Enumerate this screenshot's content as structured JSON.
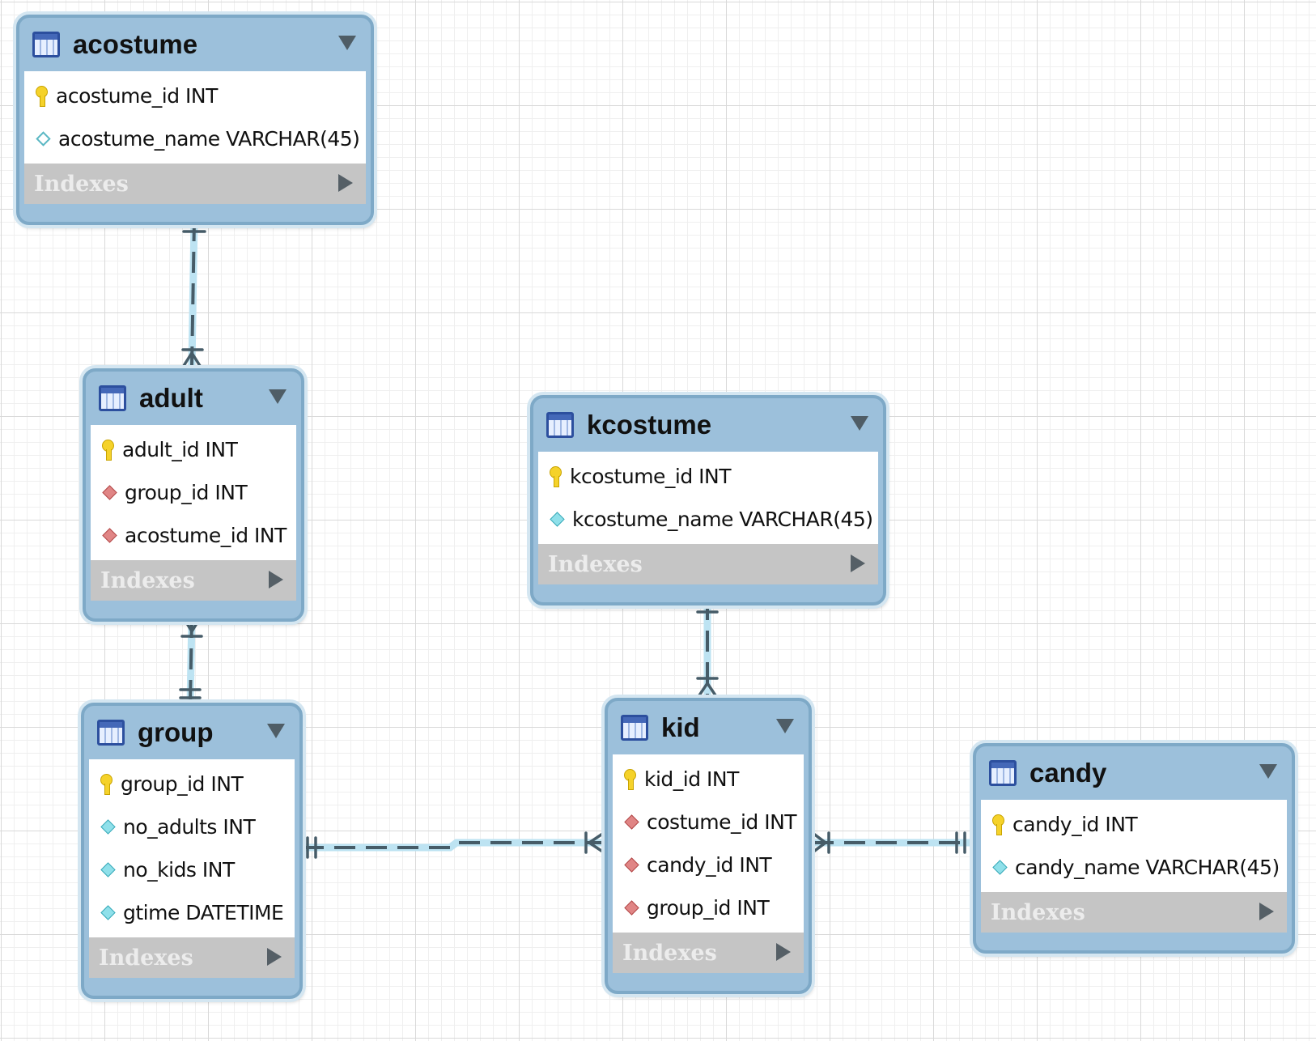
{
  "diagram": {
    "tables": [
      {
        "name": "acostume",
        "columns": [
          {
            "text": "acostume_id INT",
            "kind": "pk"
          },
          {
            "text": "acostume_name VARCHAR(45)",
            "kind": "hollow"
          }
        ],
        "indexes_label": "Indexes"
      },
      {
        "name": "adult",
        "columns": [
          {
            "text": "adult_id INT",
            "kind": "pk"
          },
          {
            "text": "group_id INT",
            "kind": "fk"
          },
          {
            "text": "acostume_id INT",
            "kind": "fk"
          }
        ],
        "indexes_label": "Indexes"
      },
      {
        "name": "kcostume",
        "columns": [
          {
            "text": "kcostume_id INT",
            "kind": "pk"
          },
          {
            "text": "kcostume_name VARCHAR(45)",
            "kind": "attr"
          }
        ],
        "indexes_label": "Indexes"
      },
      {
        "name": "group",
        "columns": [
          {
            "text": "group_id INT",
            "kind": "pk"
          },
          {
            "text": "no_adults INT",
            "kind": "attr"
          },
          {
            "text": "no_kids INT",
            "kind": "attr"
          },
          {
            "text": "gtime DATETIME",
            "kind": "attr"
          }
        ],
        "indexes_label": "Indexes"
      },
      {
        "name": "kid",
        "columns": [
          {
            "text": "kid_id INT",
            "kind": "pk"
          },
          {
            "text": "costume_id INT",
            "kind": "fk"
          },
          {
            "text": "candy_id INT",
            "kind": "fk"
          },
          {
            "text": "group_id INT",
            "kind": "fk"
          }
        ],
        "indexes_label": "Indexes"
      },
      {
        "name": "candy",
        "columns": [
          {
            "text": "candy_id INT",
            "kind": "pk"
          },
          {
            "text": "candy_name VARCHAR(45)",
            "kind": "attr"
          }
        ],
        "indexes_label": "Indexes"
      }
    ],
    "relationships": [
      {
        "from": "acostume",
        "to": "adult",
        "from_card": "one",
        "to_card": "many"
      },
      {
        "from": "group",
        "to": "adult",
        "from_card": "one",
        "to_card": "many"
      },
      {
        "from": "kcostume",
        "to": "kid",
        "from_card": "one",
        "to_card": "many"
      },
      {
        "from": "group",
        "to": "kid",
        "from_card": "one",
        "to_card": "many"
      },
      {
        "from": "candy",
        "to": "kid",
        "from_card": "one",
        "to_card": "many"
      }
    ],
    "colors": {
      "table_header": "#9cc0db",
      "table_border": "#7ea9c7",
      "indexes_bar": "#c5c5c5",
      "connector": "#465c68",
      "connector_glow": "#bde3f2",
      "primary_key": "#f5d22a",
      "foreign_key": "#e08585",
      "attribute": "#8fe0ea"
    }
  }
}
